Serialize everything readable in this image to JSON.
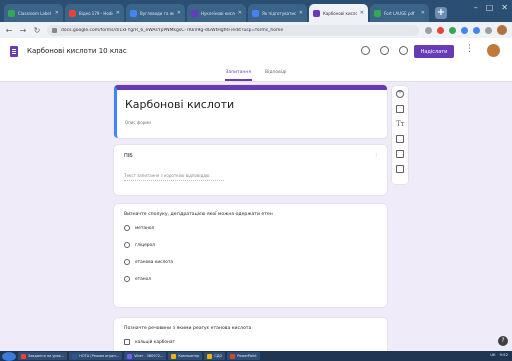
{
  "browser": {
    "tabs": [
      {
        "title": "Classroom Label St",
        "icon_color": "#34a853"
      },
      {
        "title": "Відео 179 - Hodie",
        "icon_color": "#ea4335"
      },
      {
        "title": "Вуглеводи та жири",
        "icon_color": "#4285f4"
      },
      {
        "title": "Нуклеїнові кислоти",
        "icon_color": "#673ab7"
      },
      {
        "title": "Як підготуватися",
        "icon_color": "#4285f4"
      },
      {
        "title": "Карбонові кислот",
        "icon_color": "#673ab7",
        "active": true
      },
      {
        "title": "Fort LAUGE pdf",
        "icon_color": "#34a853"
      }
    ],
    "new_tab_label": "+",
    "url": "docs.google.com/forms/d/1xFYgrR_6_eWAsYpPNMkgsC-7KkV9g-dGWtHgfRF/edit?usp=forms_home",
    "window_controls": [
      "–",
      "□",
      "✕"
    ]
  },
  "forms_header": {
    "doc_title": "Карбонові кислоти 10 клас",
    "send_label": "Надіслати",
    "more_label": "⋮"
  },
  "form_tabs": {
    "questions": "Запитання",
    "responses": "Відповіді"
  },
  "form": {
    "title": "Карбонові кислоти",
    "description": "Опис форми",
    "q1": {
      "label": "ПІБ",
      "hint": "Текст запитання з короткою відповіддю",
      "drag_handle": "⁝"
    },
    "q2": {
      "title": "Визначте сполуку, дегідратацією якої можна одержати етен",
      "options": [
        "метанол",
        "гліцерол",
        "етанова кислота",
        "етанол"
      ]
    },
    "q3": {
      "title": "Позначте речовини з якими реагує етанова кислота",
      "options": [
        "кальцій карбонат"
      ]
    }
  },
  "side_toolbar": [
    "add-question-icon",
    "import-questions-icon",
    "title-text-icon",
    "image-icon",
    "video-icon",
    "section-icon"
  ],
  "help_label": "?",
  "taskbar": {
    "items": [
      {
        "label": "Завдання на урок...",
        "icon_color": "#ea4335"
      },
      {
        "label": "НОТА (Режим огран...",
        "icon_color": "#2b579a"
      },
      {
        "label": "Viber - 380972...",
        "icon_color": "#7360f2"
      },
      {
        "label": "Компьютер",
        "icon_color": "#f4b400"
      },
      {
        "label": "СДО",
        "icon_color": "#f4b400"
      },
      {
        "label": "PowerPoint",
        "icon_color": "#d24726"
      }
    ],
    "tray_lang": "UK",
    "tray_time": "9:52"
  }
}
